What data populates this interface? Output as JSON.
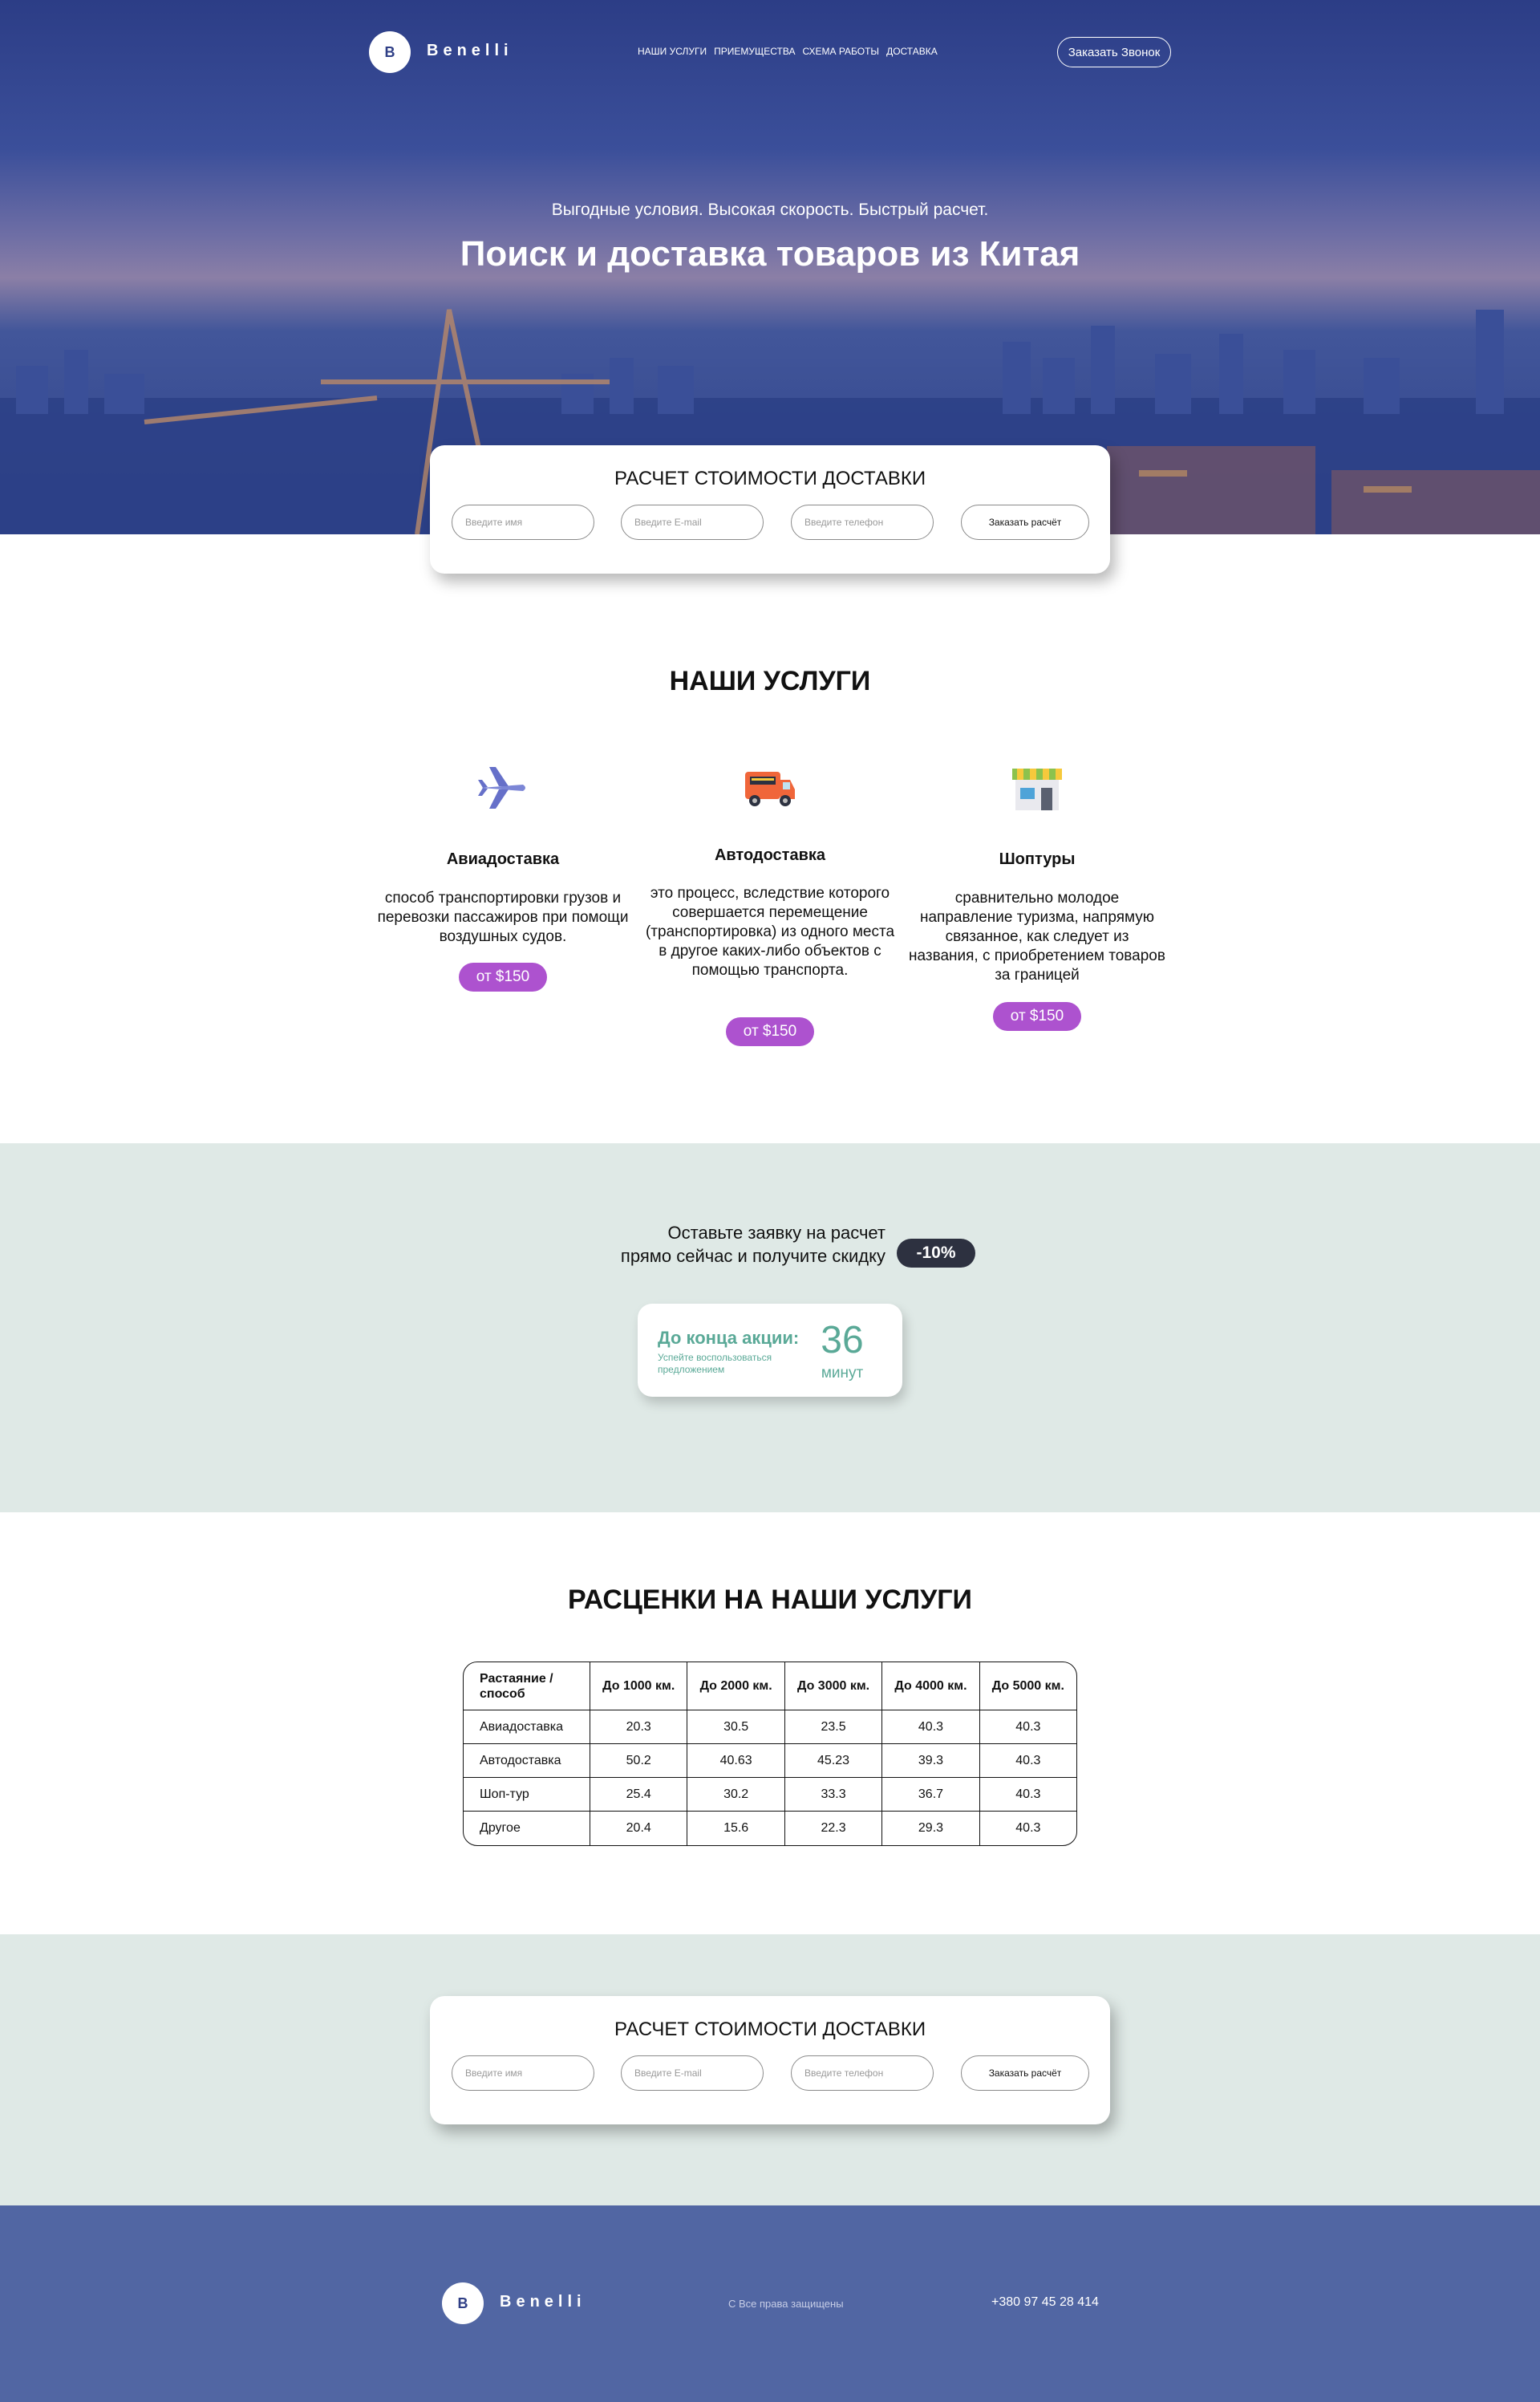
{
  "header": {
    "logo_letter": "B",
    "brand": "Benelli",
    "menu": [
      "НАШИ УСЛУГИ",
      "ПРИЕМУЩЕСТВА",
      "СХЕМА РАБОТЫ",
      "ДОСТАВКА"
    ],
    "call_button": "Заказать Звонок"
  },
  "hero": {
    "subtitle": "Выгодные условия. Высокая скорость. Быстрый расчет.",
    "title": "Поиск и доставка товаров из Китая"
  },
  "calc_form": {
    "title": "РАСЧЕТ СТОИМОСТИ ДОСТАВКИ",
    "name_placeholder": "Введите имя",
    "email_placeholder": "Введите E-mail",
    "phone_placeholder": "Введите телефон",
    "submit": "Заказать расчёт"
  },
  "services": {
    "title": "НАШИ УСЛУГИ",
    "items": [
      {
        "icon": "airplane-icon",
        "name": "Авиадоставка",
        "description": "способ транспортировки грузов и перевозки пассажиров при помощи воздушных судов.",
        "price": "от $150"
      },
      {
        "icon": "truck-icon",
        "name": "Автодоставка",
        "description": "это процесс, вследствие которого совершается перемещение (транспортировка) из одного места в другое каких-либо объектов с помощью транспорта.",
        "price": "от $150"
      },
      {
        "icon": "shop-icon",
        "name": "Шоптуры",
        "description": "сравнительно молодое направление туризма, напрямую связанное, как следует из названия, с приобретением товаров за границей",
        "price": "от $150"
      }
    ]
  },
  "promo": {
    "text_line1": "Оставьте заявку на расчет",
    "text_line2": "прямо сейчас и получите скидку",
    "discount": "-10%",
    "timer_label": "До конца акции:",
    "timer_hint": "Успейте воспользоваться предложением",
    "timer_value": "36",
    "timer_unit": "минут"
  },
  "prices": {
    "title": "РАСЦЕНКИ НА НАШИ УСЛУГИ",
    "headers": [
      "Растаяние / способ",
      "До 1000 км.",
      "До 2000 км.",
      "До 3000 км.",
      "До 4000 км.",
      "До 5000 км."
    ],
    "rows": [
      [
        "Авиадоставка",
        "20.3",
        "30.5",
        "23.5",
        "40.3",
        "40.3"
      ],
      [
        "Автодоставка",
        "50.2",
        "40.63",
        "45.23",
        "39.3",
        "40.3"
      ],
      [
        "Шоп-тур",
        "25.4",
        "30.2",
        "33.3",
        "36.7",
        "40.3"
      ],
      [
        "Другое",
        "20.4",
        "15.6",
        "22.3",
        "29.3",
        "40.3"
      ]
    ]
  },
  "footer": {
    "logo_letter": "B",
    "brand": "Benelli",
    "rights": "С Все права защищены",
    "phone": "+380 97 45 28 414"
  },
  "colors": {
    "hero_blue": "#2f438a",
    "price_pill": "#ad52cf",
    "promo_bg": "#dfe9e6",
    "accent_green": "#5aa997",
    "discount_badge": "#2d3140",
    "footer_bg": "#5166a3"
  }
}
